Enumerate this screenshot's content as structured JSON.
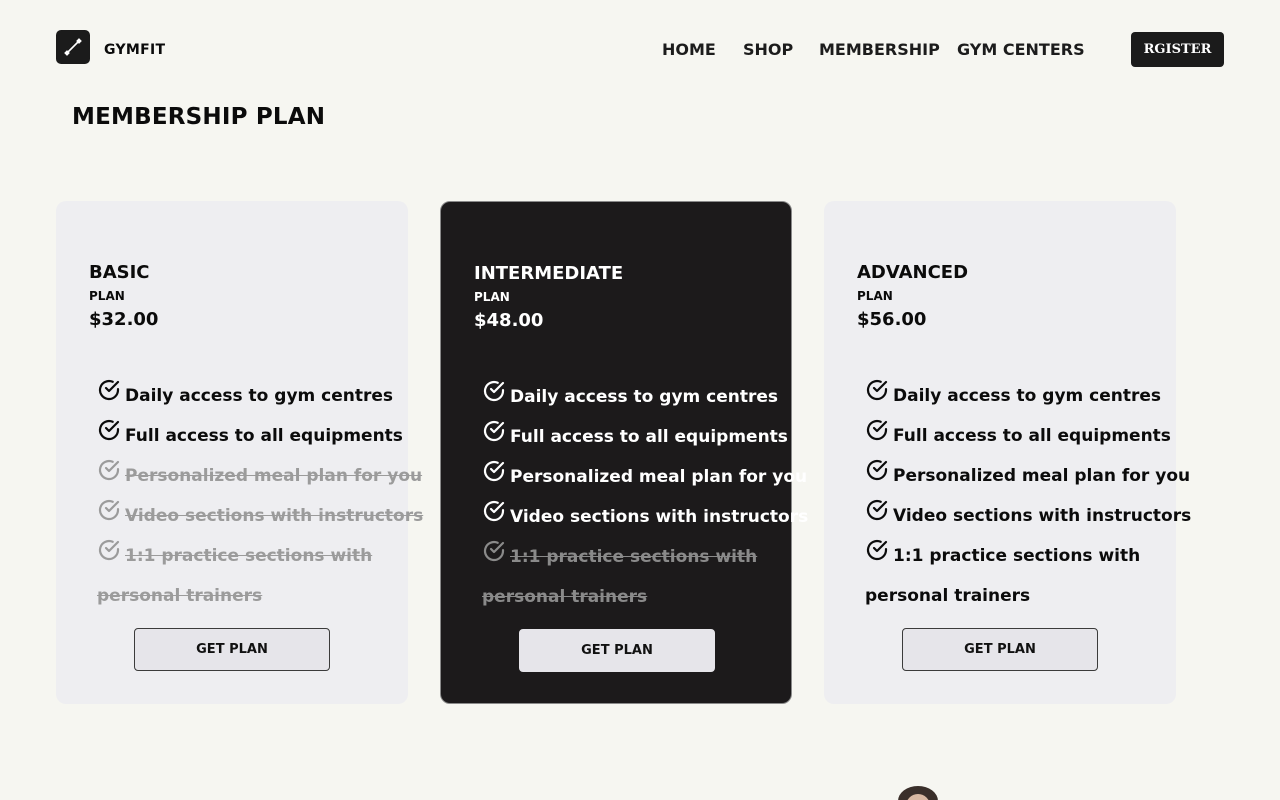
{
  "header": {
    "brand": "GYMFIT",
    "nav": [
      "HOME",
      "SHOP",
      "MEMBERSHIP",
      "GYM CENTERS"
    ],
    "register_label": "RGISTER"
  },
  "page_title": "MEMBERSHIP PLAN",
  "plans": [
    {
      "name": "BASIC",
      "label": "PLAN",
      "price": "$32.00",
      "features": [
        {
          "text": "Daily access to gym centres",
          "included": true
        },
        {
          "text": "Full access to all equipments",
          "included": true
        },
        {
          "text": "Personalized meal plan for you",
          "included": false
        },
        {
          "text": "Video sections with instructors",
          "included": false
        },
        {
          "text": "1:1 practice sections with personal trainers",
          "included": false
        }
      ],
      "cta": "GET PLAN"
    },
    {
      "name": "INTERMEDIATE",
      "label": "PLAN",
      "price": "$48.00",
      "features": [
        {
          "text": "Daily access to gym centres",
          "included": true
        },
        {
          "text": "Full access to all equipments",
          "included": true
        },
        {
          "text": "Personalized meal plan for you",
          "included": true
        },
        {
          "text": "Video sections with instructors",
          "included": true
        },
        {
          "text": "1:1 practice sections with personal trainers",
          "included": false
        }
      ],
      "cta": "GET PLAN"
    },
    {
      "name": "ADVANCED",
      "label": "PLAN",
      "price": "$56.00",
      "features": [
        {
          "text": "Daily access to gym centres",
          "included": true
        },
        {
          "text": "Full access to all equipments",
          "included": true
        },
        {
          "text": "Personalized meal plan for you",
          "included": true
        },
        {
          "text": "Video sections with instructors",
          "included": true
        },
        {
          "text": "1:1 practice sections with personal trainers",
          "included": true
        }
      ],
      "cta": "GET PLAN"
    }
  ],
  "colors": {
    "background": "#f6f6f1",
    "card_light": "#eeeef1",
    "card_dark": "#1c1a1b",
    "excluded_text": "#9b9b9b"
  }
}
